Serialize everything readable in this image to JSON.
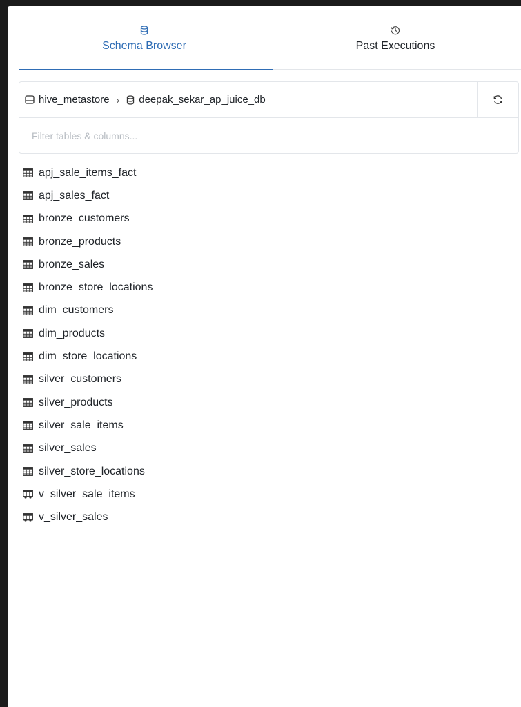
{
  "tabs": [
    {
      "label": "Schema Browser",
      "icon": "database-icon",
      "active": true
    },
    {
      "label": "Past Executions",
      "icon": "history-icon",
      "active": false
    }
  ],
  "breadcrumb": {
    "catalog": {
      "label": "hive_metastore",
      "icon": "catalog-icon"
    },
    "separator": "›",
    "schema": {
      "label": "deepak_sekar_ap_juice_db",
      "icon": "schema-icon"
    }
  },
  "refresh": {
    "icon": "refresh-icon"
  },
  "filter": {
    "placeholder": "Filter tables & columns...",
    "value": ""
  },
  "tables": [
    {
      "name": "apj_sale_items_fact",
      "type": "table"
    },
    {
      "name": "apj_sales_fact",
      "type": "table"
    },
    {
      "name": "bronze_customers",
      "type": "table"
    },
    {
      "name": "bronze_products",
      "type": "table"
    },
    {
      "name": "bronze_sales",
      "type": "table"
    },
    {
      "name": "bronze_store_locations",
      "type": "table"
    },
    {
      "name": "dim_customers",
      "type": "table"
    },
    {
      "name": "dim_products",
      "type": "table"
    },
    {
      "name": "dim_store_locations",
      "type": "table"
    },
    {
      "name": "silver_customers",
      "type": "table"
    },
    {
      "name": "silver_products",
      "type": "table"
    },
    {
      "name": "silver_sale_items",
      "type": "table"
    },
    {
      "name": "silver_sales",
      "type": "table"
    },
    {
      "name": "silver_store_locations",
      "type": "table"
    },
    {
      "name": "v_silver_sale_items",
      "type": "view"
    },
    {
      "name": "v_silver_sales",
      "type": "view"
    }
  ],
  "colors": {
    "accent": "#2f6db5",
    "text": "#1f2328",
    "border": "#e3e6ea",
    "placeholder": "#b7bcc2"
  }
}
